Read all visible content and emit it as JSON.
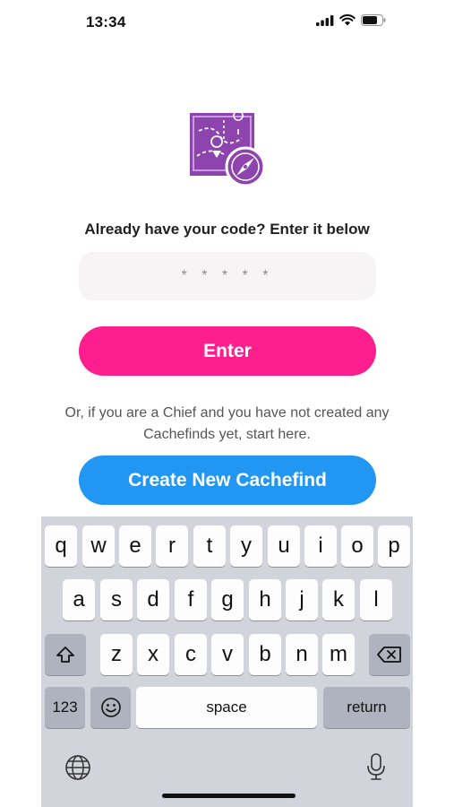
{
  "status_bar": {
    "time": "13:34"
  },
  "prompt": "Already have your code? Enter it below",
  "code_input": {
    "placeholder": "* * * * *",
    "value": ""
  },
  "enter_button": "Enter",
  "chief_text": "Or, if you are a Chief and you have not created any Cachefinds yet, start here.",
  "create_button": "Create New Cachefind",
  "keyboard": {
    "row1": [
      "q",
      "w",
      "e",
      "r",
      "t",
      "y",
      "u",
      "i",
      "o",
      "p"
    ],
    "row2": [
      "a",
      "s",
      "d",
      "f",
      "g",
      "h",
      "j",
      "k",
      "l"
    ],
    "row3": [
      "z",
      "x",
      "c",
      "v",
      "b",
      "n",
      "m"
    ],
    "numbers_key": "123",
    "space_key": "space",
    "return_key": "return"
  },
  "colors": {
    "accent_pink": "#ff1e8e",
    "accent_blue": "#2196f3",
    "logo_purple": "#8e44ad"
  }
}
